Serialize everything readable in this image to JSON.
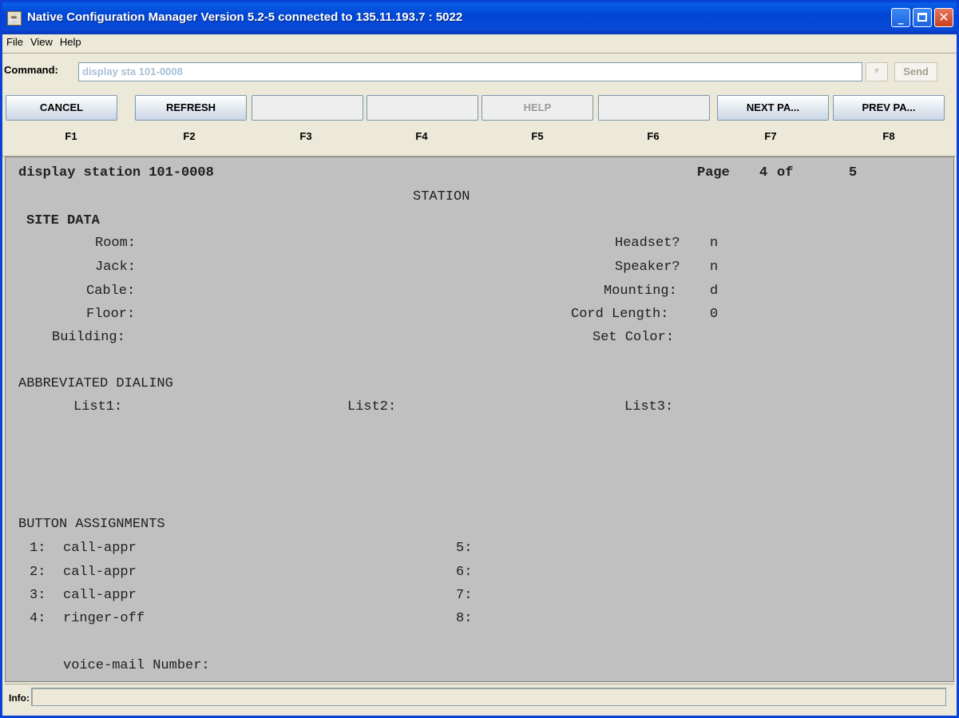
{
  "window": {
    "title": "Native Configuration Manager Version 5.2-5 connected to 135.11.193.7 : 5022",
    "app_icon": "java-cup-icon",
    "controls": {
      "minimize": "_",
      "maximize": "",
      "close": "✕"
    }
  },
  "menu": [
    "File",
    "View",
    "Help"
  ],
  "command": {
    "label": "Command:",
    "value": "display sta 101-0008",
    "dropdown_glyph": "▼",
    "send_label": "Send"
  },
  "fkeys": [
    {
      "label": "CANCEL",
      "key": "F1"
    },
    {
      "label": "REFRESH",
      "key": "F2"
    },
    {
      "label": "",
      "key": "F3"
    },
    {
      "label": "",
      "key": "F4"
    },
    {
      "label": "HELP",
      "key": "F5"
    },
    {
      "label": "",
      "key": "F6"
    },
    {
      "label": "NEXT  PA...",
      "key": "F7"
    },
    {
      "label": "PREV  PA...",
      "key": "F8"
    }
  ],
  "screen": {
    "header": "display station 101-0008",
    "page_label": "Page",
    "page_current": "4",
    "page_of": "of",
    "page_total": "5",
    "form_title": "STATION",
    "site_data": {
      "heading": "SITE DATA",
      "room_label": "Room:",
      "jack_label": "Jack:",
      "cable_label": "Cable:",
      "floor_label": "Floor:",
      "building_label": "Building:",
      "headset_label": "Headset?",
      "headset_value": "n",
      "speaker_label": "Speaker?",
      "speaker_value": "n",
      "mounting_label": "Mounting:",
      "mounting_value": "d",
      "cord_length_label": "Cord Length:",
      "cord_length_value": "0",
      "set_color_label": "Set Color:"
    },
    "abbreviated_dialing": {
      "heading": "ABBREVIATED DIALING",
      "list1_label": "List1:",
      "list2_label": "List2:",
      "list3_label": "List3:"
    },
    "button_assignments": {
      "heading": "BUTTON ASSIGNMENTS",
      "left": [
        {
          "num": "1:",
          "value": "call-appr"
        },
        {
          "num": "2:",
          "value": "call-appr"
        },
        {
          "num": "3:",
          "value": "call-appr"
        },
        {
          "num": "4:",
          "value": "ringer-off"
        }
      ],
      "right": [
        "5:",
        "6:",
        "7:",
        "8:"
      ]
    },
    "voice_mail_label": "voice-mail Number:"
  },
  "info": {
    "label": "Info:",
    "value": ""
  }
}
